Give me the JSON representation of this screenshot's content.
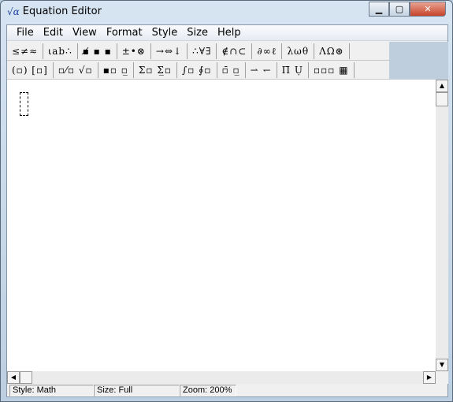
{
  "window": {
    "title": "Equation Editor",
    "app_icon": "√α"
  },
  "menu": [
    "File",
    "Edit",
    "View",
    "Format",
    "Style",
    "Size",
    "Help"
  ],
  "toolbar": {
    "row1": [
      "≤≠≈",
      "⍳ab∴",
      "▪̸ ▪ ▪",
      "±•⊗",
      "→⇔↓",
      "∴∀∃",
      "∉∩⊂",
      "∂∞ℓ",
      "λωθ",
      "ΛΩ⊛"
    ],
    "row2": [
      "(▫) [▫]",
      "▫⁄▫ √▫",
      "▪▫ ▫̲",
      "Σ▫ Σ̲▫",
      "∫▫ ∮▫",
      "▫̄ ▫̲",
      "⇀ ↽",
      "Π̄ Ụ",
      "▫▫▫ ▦"
    ]
  },
  "status": {
    "style": "Style: Math",
    "size": "Size: Full",
    "zoom": "Zoom: 200%"
  }
}
